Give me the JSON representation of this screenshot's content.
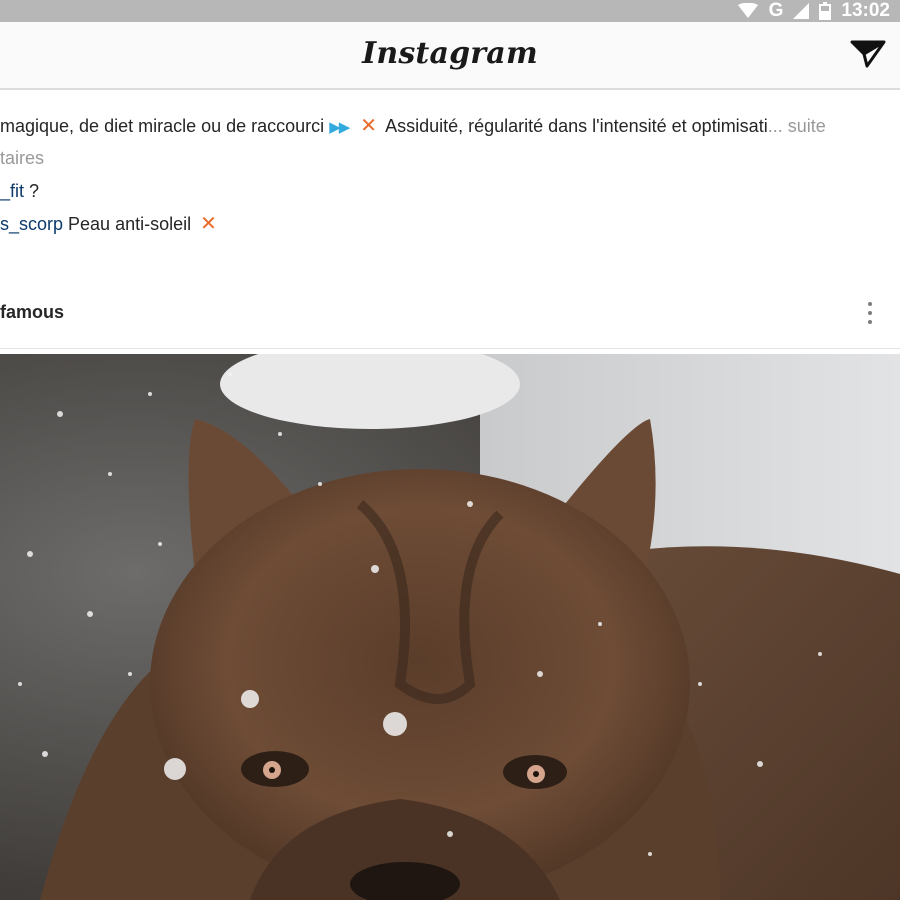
{
  "status_bar": {
    "network": "G",
    "time": "13:02",
    "icons": [
      "wifi-icon",
      "signal-icon",
      "battery-icon"
    ]
  },
  "header": {
    "logo": "Instagram",
    "direct_icon": "paper-plane-icon"
  },
  "caption": {
    "line1_text": "magique, de diet miracle ou de raccourci",
    "line1_arrows": "▶▶",
    "line1_cross": "✕",
    "line1_rest": "Assiduité, régularité dans l'intensité et optimisati",
    "line1_ellipsis": "...",
    "more": "suite",
    "line2": "taires"
  },
  "comments": [
    {
      "user": "_fit",
      "text": " ?"
    },
    {
      "user": "s_scorp",
      "text": " Peau anti-soleil",
      "cross": "✕"
    }
  ],
  "post": {
    "username": "famous",
    "menu_icon": "more-vertical-icon",
    "image": "snowy-brown-dog-photo"
  },
  "colors": {
    "status_bar_bg": "#b7b7b7",
    "link_blue": "#0e3a6b",
    "arrow_blue": "#33aadd",
    "cross_orange": "#ea6a2a",
    "muted_gray": "#999999"
  }
}
